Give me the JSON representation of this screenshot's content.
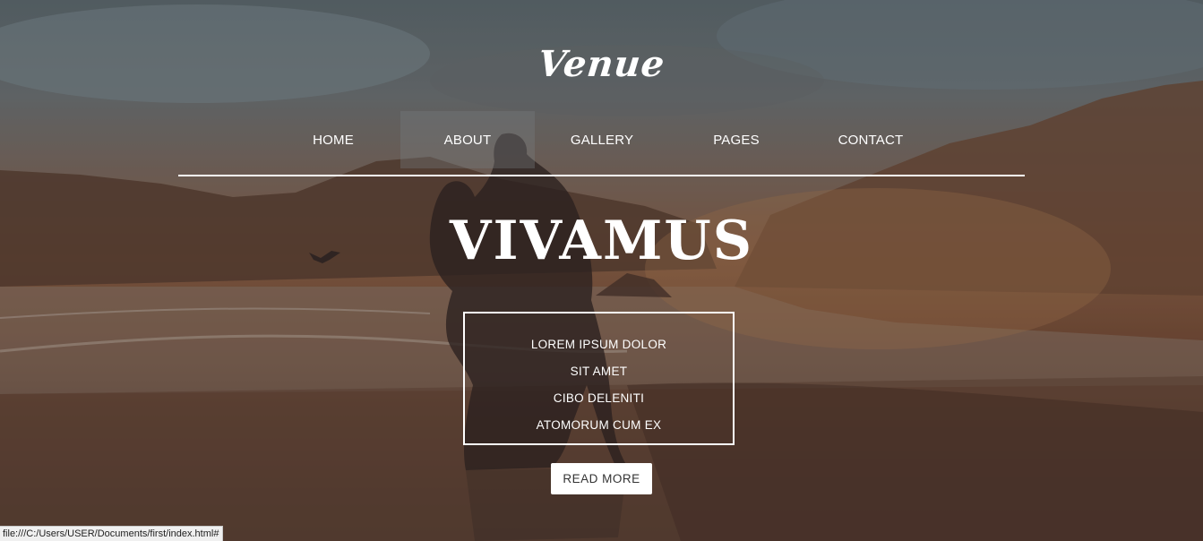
{
  "site": {
    "logo": "Venue"
  },
  "nav": {
    "items": [
      {
        "label": "HOME",
        "active": false
      },
      {
        "label": "ABOUT",
        "active": true
      },
      {
        "label": "GALLERY",
        "active": false
      },
      {
        "label": "PAGES",
        "active": false
      },
      {
        "label": "CONTACT",
        "active": false
      }
    ]
  },
  "hero": {
    "headline": "VIVAMUS",
    "info_lines": [
      "LOREM IPSUM DOLOR",
      "SIT AMET",
      "CIBO DELENITI",
      "ATOMORUM CUM EX"
    ],
    "button_label": "READ MORE"
  },
  "status_bar": {
    "url": "file:///C:/Users/USER/Documents/first/index.html#"
  },
  "colors": {
    "text": "#ffffff",
    "button_bg": "#ffffff",
    "button_text": "#333333",
    "active_nav_bg": "#7a7f84"
  }
}
